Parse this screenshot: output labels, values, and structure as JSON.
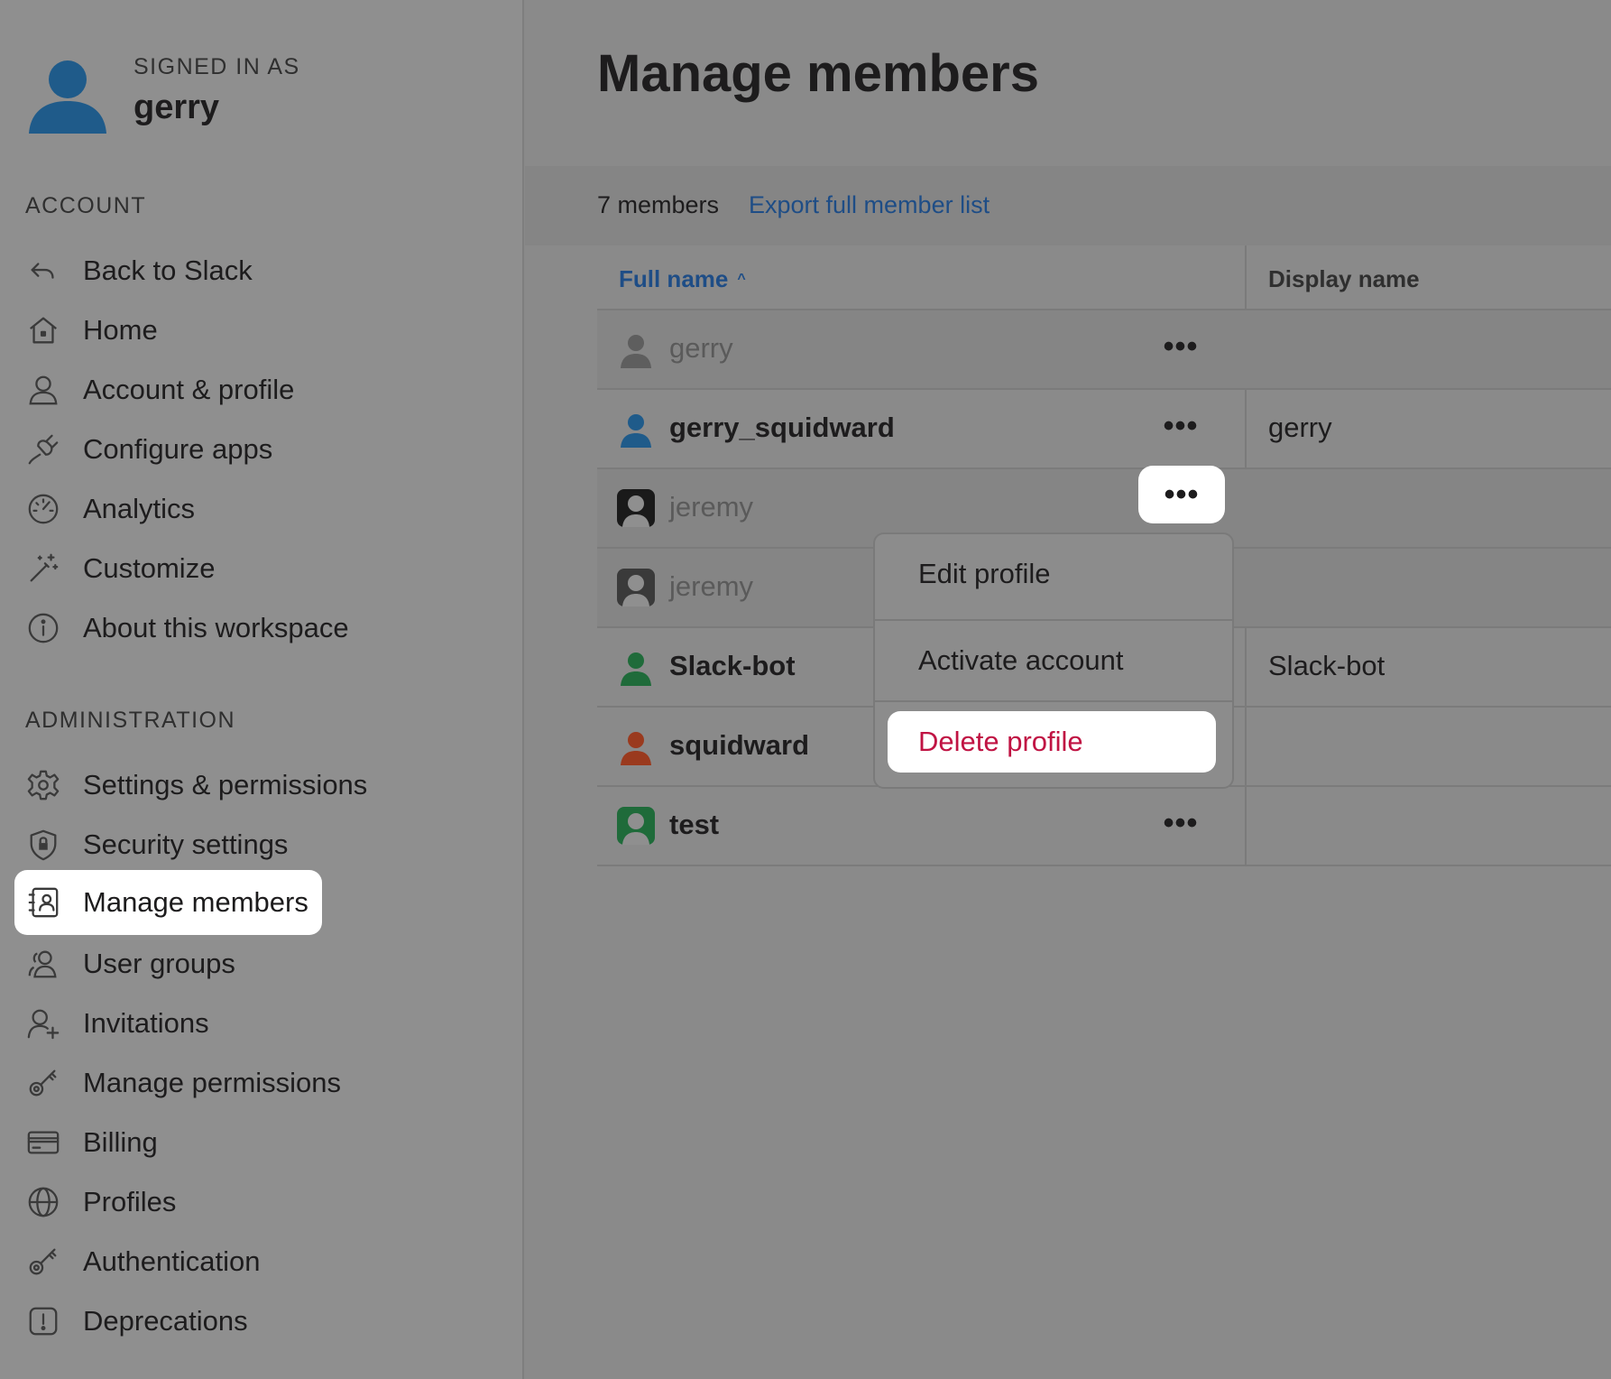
{
  "sidebar": {
    "signed_in_label": "SIGNED IN AS",
    "username": "gerry",
    "account_label": "ACCOUNT",
    "account_items": [
      {
        "label": "Back to Slack",
        "icon": "back-arrow-icon"
      },
      {
        "label": "Home",
        "icon": "home-icon"
      },
      {
        "label": "Account & profile",
        "icon": "person-icon"
      },
      {
        "label": "Configure apps",
        "icon": "plug-icon"
      },
      {
        "label": "Analytics",
        "icon": "gauge-icon"
      },
      {
        "label": "Customize",
        "icon": "magic-wand-icon"
      },
      {
        "label": "About this workspace",
        "icon": "info-icon"
      }
    ],
    "admin_label": "ADMINISTRATION",
    "admin_items": [
      {
        "label": "Settings & permissions",
        "icon": "gear-icon"
      },
      {
        "label": "Security settings",
        "icon": "shield-icon"
      },
      {
        "label": "Manage members",
        "icon": "contact-card-icon",
        "active": true
      },
      {
        "label": "User groups",
        "icon": "user-group-icon"
      },
      {
        "label": "Invitations",
        "icon": "add-user-icon"
      },
      {
        "label": "Manage permissions",
        "icon": "key-icon"
      },
      {
        "label": "Billing",
        "icon": "credit-card-icon"
      },
      {
        "label": "Profiles",
        "icon": "globe-icon"
      },
      {
        "label": "Authentication",
        "icon": "key-icon"
      },
      {
        "label": "Deprecations",
        "icon": "alert-icon"
      }
    ]
  },
  "main": {
    "title": "Manage members",
    "member_count": "7 members",
    "export_link": "Export full member list",
    "columns": {
      "full_name": "Full name",
      "sort_indicator": "^",
      "display_name": "Display name"
    },
    "members": [
      {
        "full_name": "gerry",
        "display_name": "",
        "style": "muted",
        "avatar_color": "#5e5e5e",
        "avatar_type": "silhouette"
      },
      {
        "full_name": "gerry_squidward",
        "display_name": "gerry",
        "style": "bold",
        "avatar_color": "#1f5b8a",
        "avatar_type": "silhouette"
      },
      {
        "full_name": "jeremy",
        "display_name": "",
        "style": "muted",
        "avatar_color": "#1a1a1a",
        "avatar_type": "framed"
      },
      {
        "full_name": "jeremy",
        "display_name": "",
        "style": "muted",
        "avatar_color": "#3a3a3a",
        "avatar_type": "framed"
      },
      {
        "full_name": "Slack-bot",
        "display_name": "Slack-bot",
        "style": "bold",
        "avatar_color": "#1f6b3a",
        "avatar_type": "silhouette"
      },
      {
        "full_name": "squidward",
        "display_name": "",
        "style": "bold",
        "avatar_color": "#9a3a1e",
        "avatar_type": "silhouette"
      },
      {
        "full_name": "test",
        "display_name": "",
        "style": "bold",
        "avatar_color": "#1f6b3a",
        "avatar_type": "framed"
      }
    ],
    "more_button_glyph": "•••",
    "context_menu": {
      "items": [
        "Edit profile",
        "Activate account",
        "Delete profile"
      ]
    }
  },
  "colors": {
    "link": "#1e4d86",
    "danger": "#c01343",
    "accent_avatar": "#1f5b8a"
  }
}
